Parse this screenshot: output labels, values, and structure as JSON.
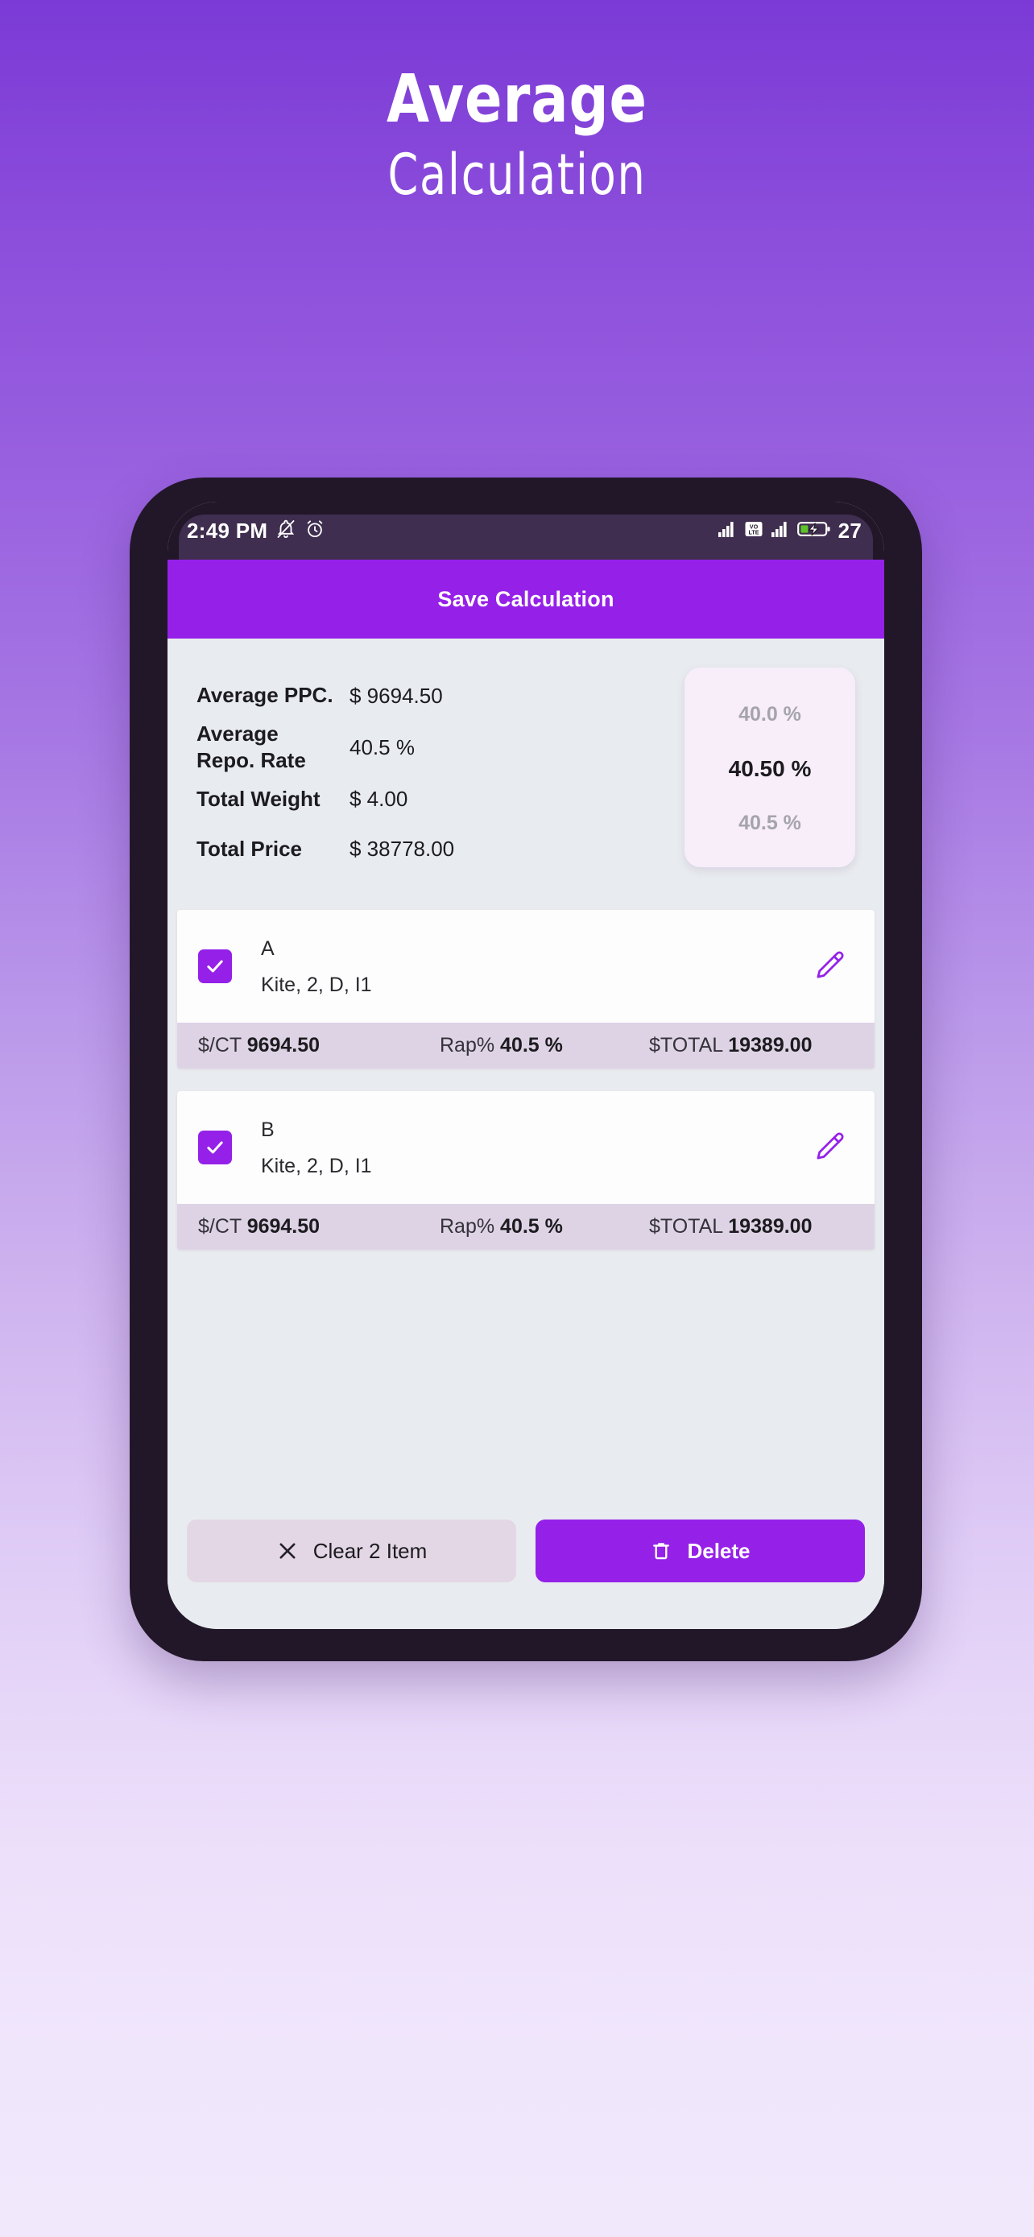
{
  "hero": {
    "line1": "Average",
    "line2": "Calculation"
  },
  "colors": {
    "brand_purple": "#9521E8",
    "hero_gradient_top": "#7B3AD6",
    "hero_gradient_bottom": "#F1E8FC",
    "phone_frame": "#221729",
    "screen_bg": "#E8EBEF",
    "stats_strip": "#DED3E5",
    "picker_card": "#F7EEFA",
    "clear_button": "#E3D7E6"
  },
  "status_bar": {
    "time": "2:49 PM",
    "left_icons": [
      "bell-muted-icon",
      "alarm-clock-icon"
    ],
    "right_icons": [
      "signal-bars-icon",
      "volte-icon",
      "signal-bars-2-icon",
      "battery-charging-icon"
    ],
    "volte_label": "VO LTE",
    "battery_percent": "27"
  },
  "appbar": {
    "title": "Save Calculation"
  },
  "summary": {
    "rows": [
      {
        "label": "Average PPC.",
        "value": "$ 9694.50"
      },
      {
        "label": "Average\nRepo. Rate",
        "label_line1": "Average",
        "label_line2": "Repo. Rate",
        "value": "40.5 %"
      },
      {
        "label": "Total Weight",
        "value": "$ 4.00"
      },
      {
        "label": "Total Price",
        "value": "$ 38778.00"
      }
    ],
    "picker": {
      "above": "40.0 %",
      "selected": "40.50 %",
      "below": "40.5 %"
    }
  },
  "items": [
    {
      "checked": true,
      "title": "A",
      "subtitle": "Kite, 2, D, I1",
      "edit_icon": "pencil-icon",
      "stats": {
        "ct_label": "$/CT",
        "ct_value": "9694.50",
        "rap_label": "Rap%",
        "rap_value": "40.5 %",
        "total_label": "$TOTAL",
        "total_value": "19389.00"
      }
    },
    {
      "checked": true,
      "title": "B",
      "subtitle": "Kite, 2, D, I1",
      "edit_icon": "pencil-icon",
      "stats": {
        "ct_label": "$/CT",
        "ct_value": "9694.50",
        "rap_label": "Rap%",
        "rap_value": "40.5 %",
        "total_label": "$TOTAL",
        "total_value": "19389.00"
      }
    }
  ],
  "bottom_bar": {
    "clear_label": "Clear 2 Item",
    "clear_icon": "close-x-icon",
    "delete_label": "Delete",
    "delete_icon": "trash-icon"
  }
}
